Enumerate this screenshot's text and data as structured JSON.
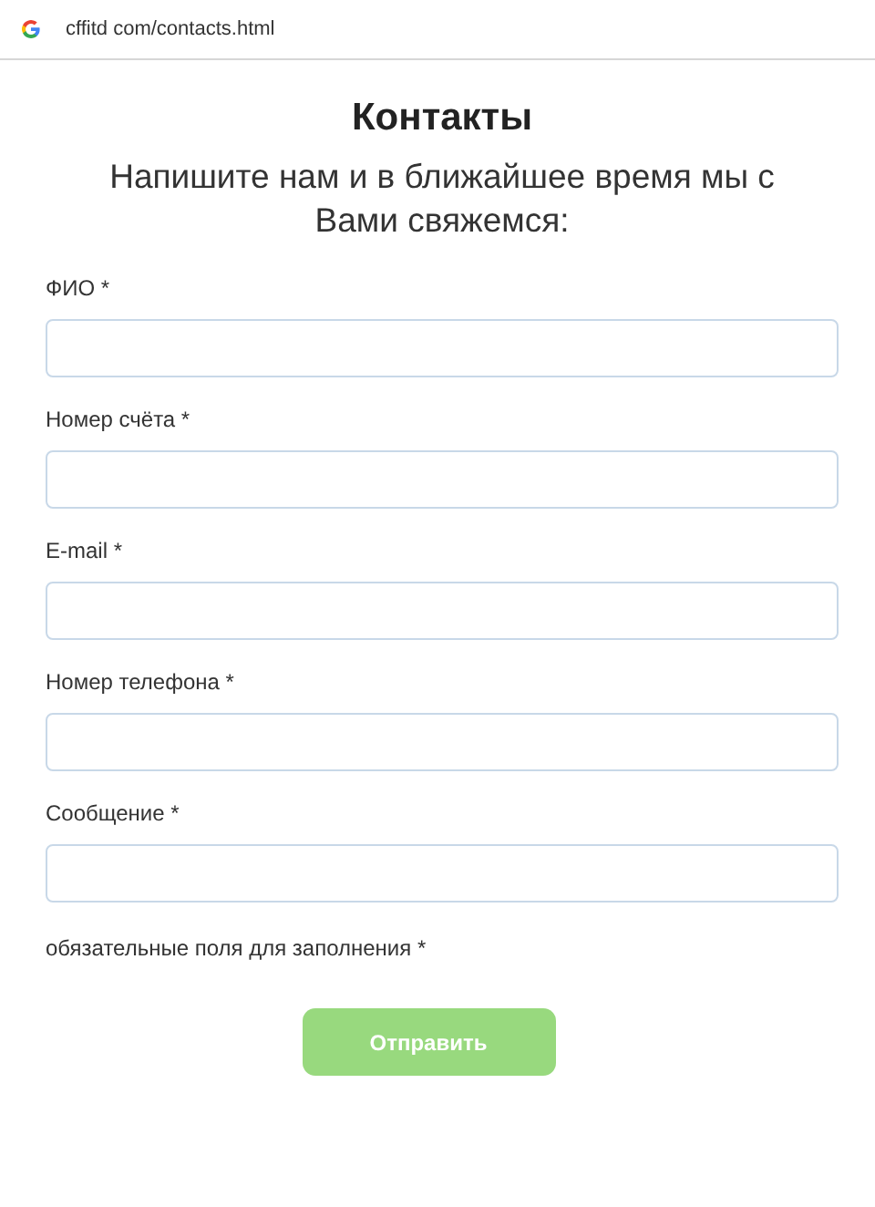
{
  "address_bar": {
    "url": "cffitd com/contacts.html"
  },
  "title": "Контакты",
  "subtitle": "Напишите нам и в ближайшее время мы с Вами свяжемся:",
  "fields": [
    {
      "label": "ФИО *"
    },
    {
      "label": "Номер счёта *"
    },
    {
      "label": "E-mail *"
    },
    {
      "label": "Номер телефона *"
    },
    {
      "label": "Сообщение *"
    }
  ],
  "required_note": "обязательные поля для заполнения *",
  "submit": {
    "label": "Отправить",
    "disabled": true
  }
}
